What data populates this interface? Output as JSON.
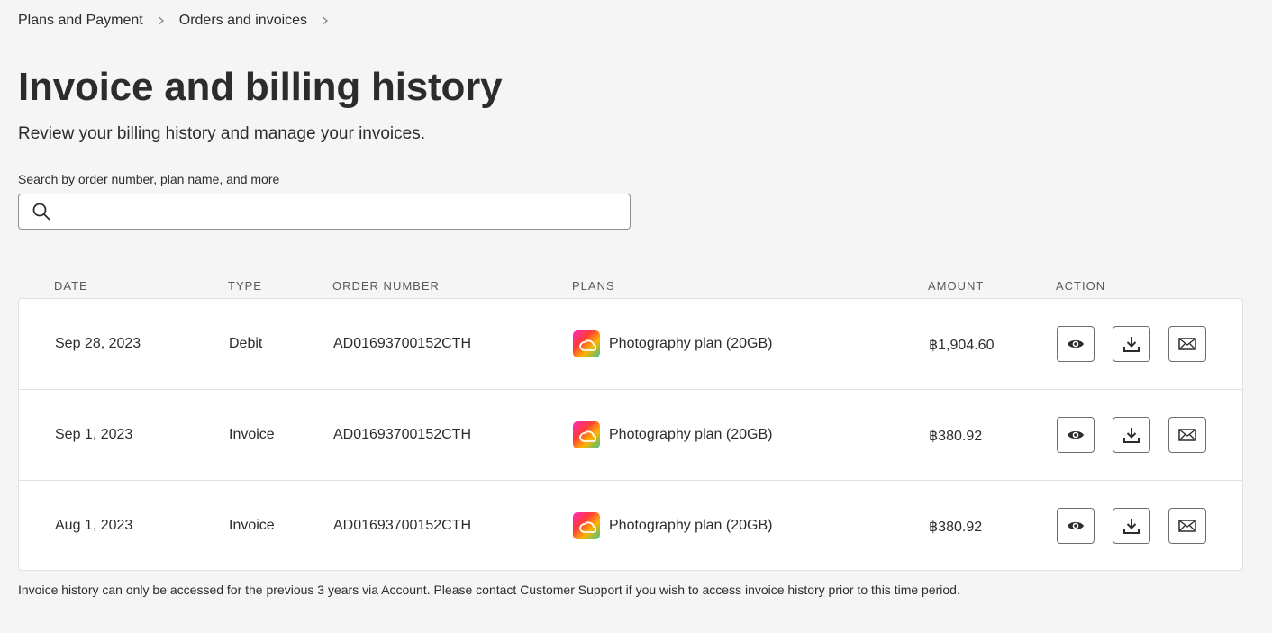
{
  "breadcrumb": {
    "items": [
      {
        "label": "Plans and Payment"
      },
      {
        "label": "Orders and invoices"
      }
    ]
  },
  "page": {
    "title": "Invoice and billing history",
    "subtitle": "Review your billing history and manage your invoices."
  },
  "search": {
    "label": "Search by order number, plan name, and more",
    "value": "",
    "placeholder": ""
  },
  "table": {
    "columns": {
      "date": "DATE",
      "type": "TYPE",
      "order": "ORDER NUMBER",
      "plans": "PLANS",
      "amount": "AMOUNT",
      "action": "ACTION"
    },
    "rows": [
      {
        "date": "Sep 28, 2023",
        "type": "Debit",
        "order": "AD01693700152CTH",
        "plan": "Photography plan (20GB)",
        "amount": "฿1,904.60"
      },
      {
        "date": "Sep 1, 2023",
        "type": "Invoice",
        "order": "AD01693700152CTH",
        "plan": "Photography plan (20GB)",
        "amount": "฿380.92"
      },
      {
        "date": "Aug 1, 2023",
        "type": "Invoice",
        "order": "AD01693700152CTH",
        "plan": "Photography plan (20GB)",
        "amount": "฿380.92"
      }
    ],
    "actions": [
      {
        "icon": "eye-icon"
      },
      {
        "icon": "download-icon"
      },
      {
        "icon": "email-icon"
      }
    ]
  },
  "footnote": "Invoice history can only be accessed for the previous 3 years via Account. Please contact Customer Support if you wish to access invoice history prior to this time period.",
  "colors": {
    "background": "#f5f5f5",
    "card": "#ffffff",
    "text": "#2c2c2c",
    "border": "#e1e1e1"
  }
}
